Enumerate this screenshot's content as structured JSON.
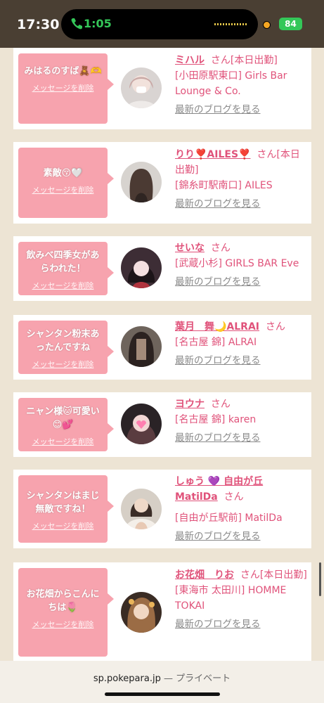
{
  "status": {
    "time": "17:30",
    "call_time": "1:05",
    "battery": "84"
  },
  "cards": [
    {
      "message": "みはるのすば🧸🫶",
      "delete_label": "メッセージを削除",
      "name": "ミハル",
      "san": "さん",
      "tag": "[本日出勤]",
      "shop": "[小田原駅東口] Girls Bar Lounge & Co.",
      "blog": "最新のブログを見る"
    },
    {
      "message": "素敵😚🤍",
      "delete_label": "メッセージを削除",
      "name": "りり❣️AILES❣️",
      "san": "さん",
      "tag": "[本日出勤]",
      "shop": "[錦糸町駅南口] AILES",
      "blog": "最新のブログを見る"
    },
    {
      "message": "飲みべ四季女があらわれた！",
      "delete_label": "メッセージを削除",
      "name": "せいな",
      "san": "さん",
      "tag": "",
      "shop": "[武蔵小杉] GIRLS BAR Eve",
      "blog": "最新のブログを見る"
    },
    {
      "message": "シャンタン粉末あったんですね",
      "delete_label": "メッセージを削除",
      "name": "葉月　舞🌙ALRAI",
      "san": "さん",
      "tag": "",
      "shop": "[名古屋 錦] ALRAI",
      "blog": "最新のブログを見る"
    },
    {
      "message": "ニャン様🐱可愛い😊💕",
      "delete_label": "メッセージを削除",
      "name": "ヨウナ",
      "san": "さん",
      "tag": "",
      "shop": "[名古屋 錦] karen",
      "blog": "最新のブログを見る"
    },
    {
      "message": "シャンタンはまじ無敵ですね！",
      "delete_label": "メッセージを削除",
      "name": "しゅう 💜 自由が丘 MatilDa",
      "san": "さん",
      "tag": "",
      "shop": "[自由が丘駅前] MatilDa",
      "blog": "最新のブログを見る"
    },
    {
      "message": "お花畑からこんにちは🌷",
      "delete_label": "メッセージを削除",
      "name": "お花畑　りお",
      "san": "さん",
      "tag": "[本日出勤]",
      "shop": "[東海市 太田川] HOMME TOKAI",
      "blog": "最新のブログを見る"
    }
  ],
  "urlbar": {
    "domain": "sp.pokepara.jp",
    "separator": " — ",
    "mode": "プライベート"
  },
  "colors": {
    "accent": "#e0527a",
    "bubble": "#f7a3ae",
    "background": "#ede4d4"
  }
}
